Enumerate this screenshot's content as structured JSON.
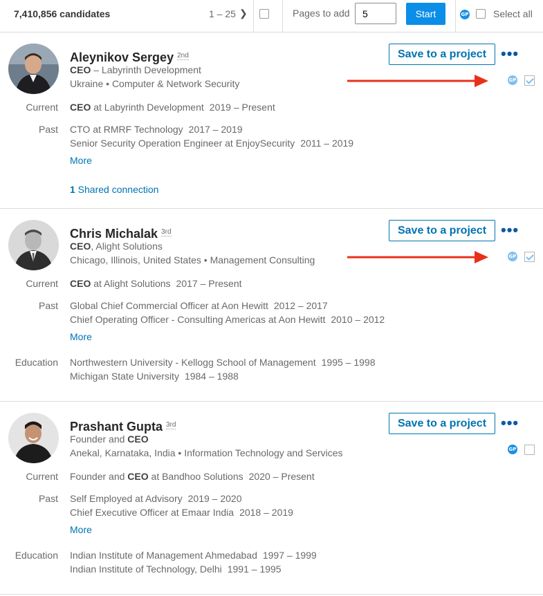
{
  "header": {
    "candidate_count": "7,410,856 candidates",
    "range": "1 – 25",
    "next_icon": "chevron-right-icon",
    "pages_to_add_label": "Pages to add",
    "pages_to_add_value": "5",
    "start_label": "Start",
    "gp_badge": "GP",
    "select_all_label": "Select all"
  },
  "accent_color": "#0a8ee8",
  "arrow_color": "#e8311a",
  "candidates": [
    {
      "name": "Aleynikov Sergey",
      "degree": "2nd",
      "headline_role": "CEO",
      "headline_rest": " – Labyrinth Development",
      "location": "Ukraine",
      "industry": "Computer & Network Security",
      "current_label": "Current",
      "current_role": "CEO",
      "current_rest": " at Labyrinth Development",
      "current_period": "2019 – Present",
      "past_label": "Past",
      "past": [
        {
          "text": "CTO at RMRF Technology",
          "period": "2017 – 2019"
        },
        {
          "text": "Senior Security Operation Engineer at EnjoySecurity",
          "period": "2011 – 2019"
        }
      ],
      "more": "More",
      "shared_count": "1",
      "shared_text": " Shared connection",
      "save_label": "Save to a project",
      "gp_badge": "GP",
      "checked": true
    },
    {
      "name": "Chris Michalak",
      "degree": "3rd",
      "headline_role": "CEO",
      "headline_rest": ", Alight Solutions",
      "location": "Chicago, Illinois, United States",
      "industry": "Management Consulting",
      "current_label": "Current",
      "current_role": "CEO",
      "current_rest": " at Alight Solutions",
      "current_period": "2017 – Present",
      "past_label": "Past",
      "past": [
        {
          "text": "Global Chief Commercial Officer at Aon Hewitt",
          "period": "2012 – 2017"
        },
        {
          "text": "Chief Operating Officer - Consulting Americas at Aon Hewitt",
          "period": "2010 – 2012"
        }
      ],
      "more": "More",
      "education_label": "Education",
      "education": [
        {
          "text": "Northwestern University - Kellogg School of Management",
          "period": "1995 – 1998"
        },
        {
          "text": "Michigan State University",
          "period": "1984 – 1988"
        }
      ],
      "save_label": "Save to a project",
      "gp_badge": "GP",
      "checked": true
    },
    {
      "name": "Prashant Gupta",
      "degree": "3rd",
      "headline_prefix": "Founder and ",
      "headline_role": "CEO",
      "location": "Anekal, Karnataka, India",
      "industry": "Information Technology and Services",
      "current_label": "Current",
      "current_prefix": "Founder and ",
      "current_role": "CEO",
      "current_rest": " at Bandhoo Solutions",
      "current_period": "2020 – Present",
      "past_label": "Past",
      "past": [
        {
          "text": "Self Employed at Advisory",
          "period": "2019 – 2020"
        },
        {
          "text": "Chief Executive Officer at Emaar India",
          "period": "2018 – 2019"
        }
      ],
      "more": "More",
      "education_label": "Education",
      "education": [
        {
          "text": "Indian Institute of Management Ahmedabad",
          "period": "1997 – 1999"
        },
        {
          "text": "Indian Institute of Technology, Delhi",
          "period": "1991 – 1995"
        }
      ],
      "save_label": "Save to a project",
      "gp_badge": "GP",
      "checked": false
    }
  ]
}
